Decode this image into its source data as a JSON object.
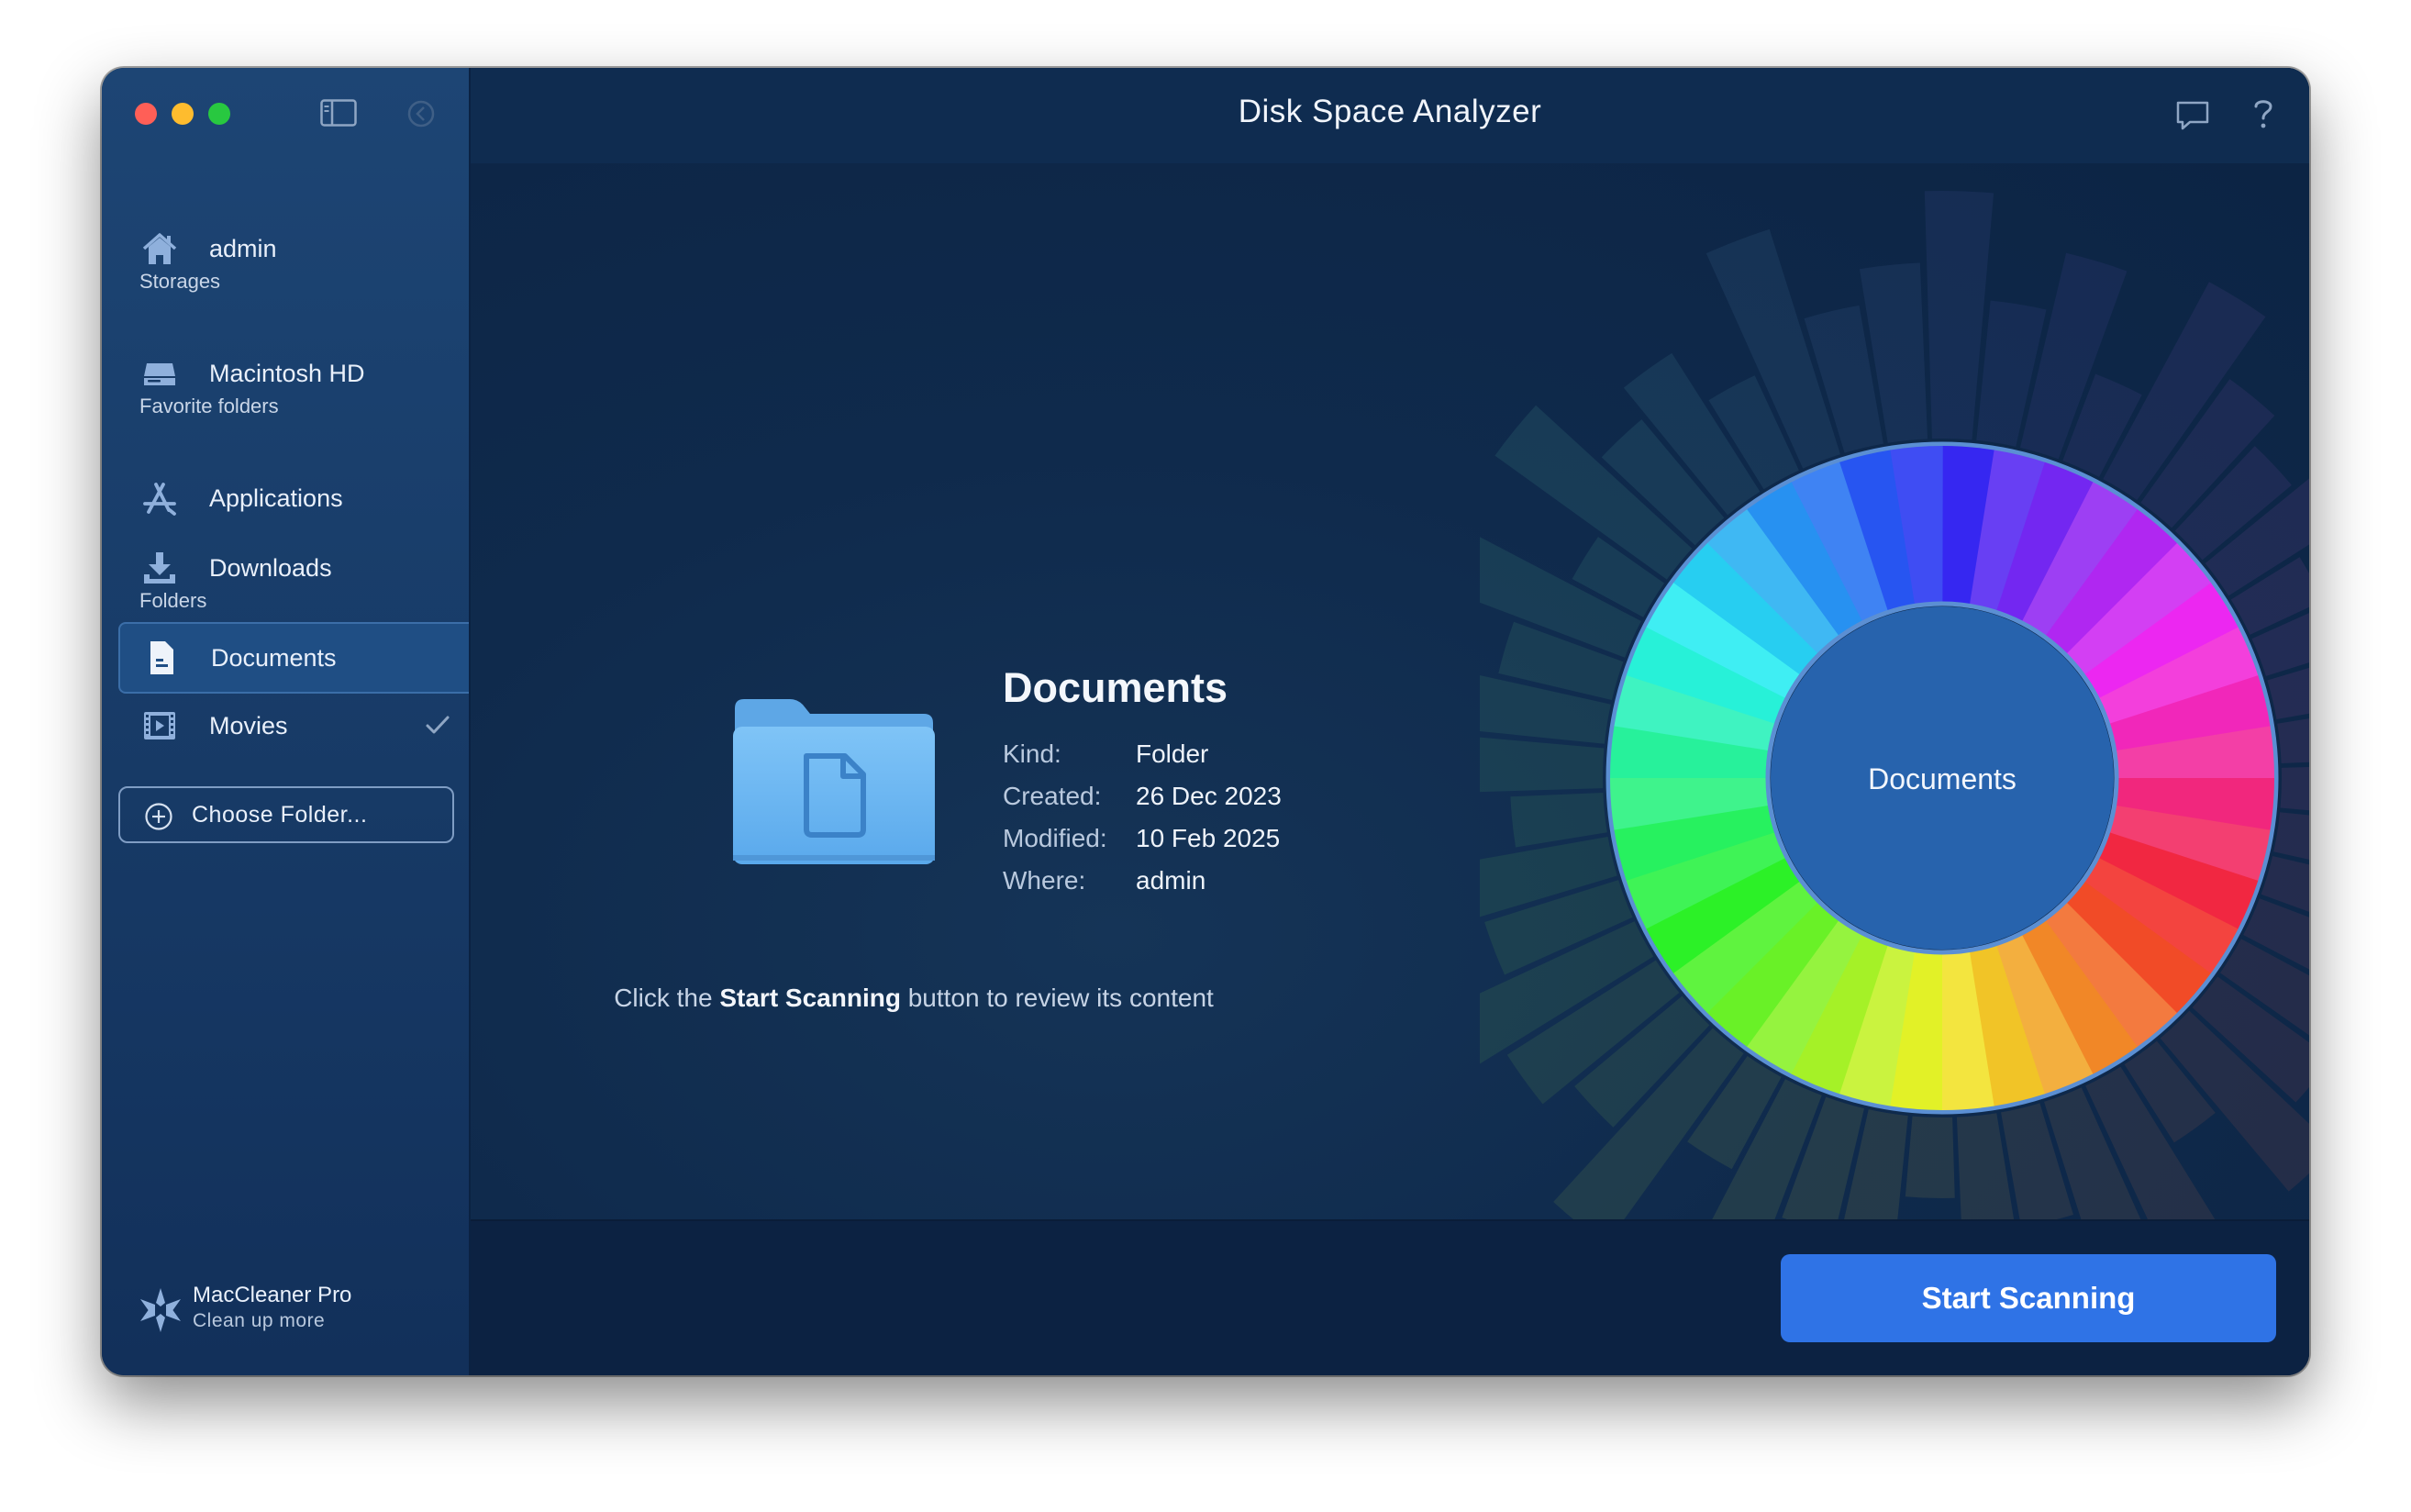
{
  "window": {
    "title": "Disk Space Analyzer"
  },
  "sidebar": {
    "home": {
      "label": "admin",
      "icon": "home-icon"
    },
    "sections": {
      "storages": "Storages",
      "favorites": "Favorite folders",
      "folders": "Folders"
    },
    "items": [
      {
        "label": "Macintosh HD",
        "icon": "drive-icon"
      },
      {
        "label": "Applications",
        "icon": "app-store-icon"
      },
      {
        "label": "Downloads",
        "icon": "download-icon"
      },
      {
        "label": "Documents",
        "icon": "document-icon",
        "selected": true
      },
      {
        "label": "Movies",
        "icon": "film-icon",
        "checked": true
      }
    ],
    "choose_folder": "Choose Folder...",
    "promo": {
      "title": "MacCleaner Pro",
      "subtitle": "Clean up more"
    }
  },
  "details": {
    "name": "Documents",
    "rows": [
      {
        "key": "Kind:",
        "value": "Folder"
      },
      {
        "key": "Created:",
        "value": "26 Dec 2023"
      },
      {
        "key": "Modified:",
        "value": "10 Feb 2025"
      },
      {
        "key": "Where:",
        "value": "admin"
      }
    ],
    "hint_pre": "Click the ",
    "hint_bold": "Start Scanning",
    "hint_post": " button to review its content"
  },
  "sunburst": {
    "center_label": "Documents",
    "segments": 40
  },
  "actions": {
    "start_scanning": "Start Scanning"
  },
  "colors": {
    "accent": "#2f73e6",
    "sidebar": "#1d4574",
    "main": "#0e2748"
  }
}
